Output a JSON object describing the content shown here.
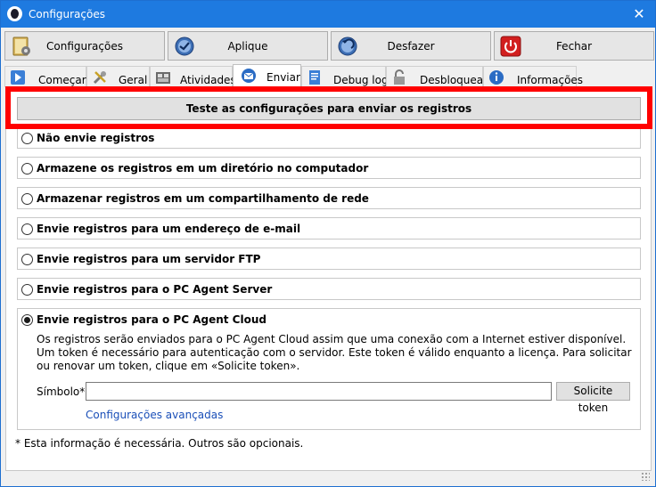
{
  "window": {
    "title": "Configurações",
    "close_glyph": "✕"
  },
  "toolbar": {
    "configuracoes": {
      "label": "Configurações",
      "icon": "settings-folder-icon"
    },
    "aplique": {
      "label": "Aplique",
      "icon": "apply-check-icon"
    },
    "desfazer": {
      "label": "Desfazer",
      "icon": "undo-icon"
    },
    "fechar": {
      "label": "Fechar",
      "icon": "power-close-icon"
    }
  },
  "tabs": [
    {
      "label": "Começar",
      "icon": "play-icon"
    },
    {
      "label": "Geral",
      "icon": "tools-icon"
    },
    {
      "label": "Atividades",
      "icon": "activities-icon"
    },
    {
      "label": "Enviar",
      "icon": "send-envelope-icon",
      "active": true
    },
    {
      "label": "Debug log",
      "icon": "debug-log-icon"
    },
    {
      "label": "Desbloquear",
      "icon": "unlock-icon"
    },
    {
      "label": "Informações",
      "icon": "info-icon"
    }
  ],
  "test_button": {
    "label": "Teste as configurações para enviar os registros"
  },
  "options": [
    {
      "label": "Não envie registros",
      "checked": false
    },
    {
      "label": "Armazene os registros em um diretório no computador",
      "checked": false
    },
    {
      "label": "Armazenar registros em um compartilhamento de rede",
      "checked": false
    },
    {
      "label": "Envie registros para um endereço de e-mail",
      "checked": false
    },
    {
      "label": "Envie registros para um servidor FTP",
      "checked": false
    },
    {
      "label": "Envie registros para o PC Agent Server",
      "checked": false
    }
  ],
  "cloud": {
    "label": "Envie registros para o PC Agent Cloud",
    "checked": true,
    "description": "Os registros serão enviados para o PC Agent Cloud assim que uma conexão com a Internet estiver disponível. Um token é necessário para autenticação com o servidor. Este token é válido enquanto a licença. Para solicitar ou renovar um token, clique em «Solicite token».",
    "token_label": "Símbolo*:",
    "token_value": "",
    "token_button": "Solicite token",
    "advanced_link": "Configurações avançadas"
  },
  "footnote": "* Esta informação é necessária. Outros são opcionais.",
  "colors": {
    "titlebar": "#1e7ae0",
    "highlight": "#ff0000",
    "link": "#1a4fb8"
  }
}
